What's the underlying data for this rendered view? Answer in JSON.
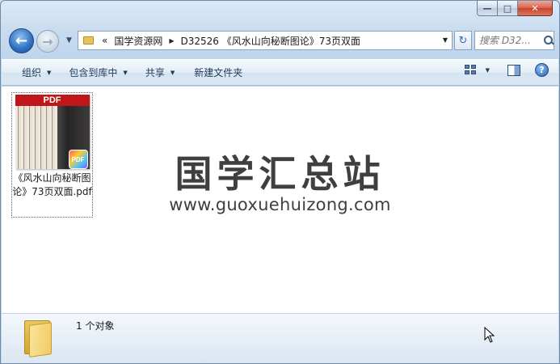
{
  "window": {
    "caption": {
      "minimize": "—",
      "maximize": "□",
      "close": "✕"
    }
  },
  "nav": {
    "back_glyph": "←",
    "forward_glyph": "→",
    "history_glyph": "▼",
    "address": {
      "overflow": "«",
      "segments": [
        "国学资源网",
        "D32526 《风水山向秘断图论》73页双面"
      ],
      "separator": "▶",
      "dropdown_glyph": "▼"
    },
    "refresh_glyph": "↻",
    "search": {
      "placeholder": "搜索 D32..."
    }
  },
  "toolbar": {
    "items": [
      {
        "label": "组织",
        "has_menu": true
      },
      {
        "label": "包含到库中",
        "has_menu": true
      },
      {
        "label": "共享",
        "has_menu": true
      },
      {
        "label": "新建文件夹",
        "has_menu": false
      }
    ],
    "menu_caret": "▼",
    "help_glyph": "?"
  },
  "content": {
    "files": [
      {
        "name": "《风水山向秘断图论》73页双面.pdf",
        "thumb_banner": "PDF",
        "badge": "PDF",
        "selected": true
      }
    ],
    "watermark": {
      "title": "国学汇总站",
      "url": "www.guoxuehuizong.com"
    }
  },
  "details": {
    "object_count": "1 个对象"
  },
  "colors": {
    "frame": "#c7dbef",
    "toolbar_text": "#1e395b",
    "pdf_banner": "#c0161a",
    "watermark": "#3f3f3f"
  }
}
